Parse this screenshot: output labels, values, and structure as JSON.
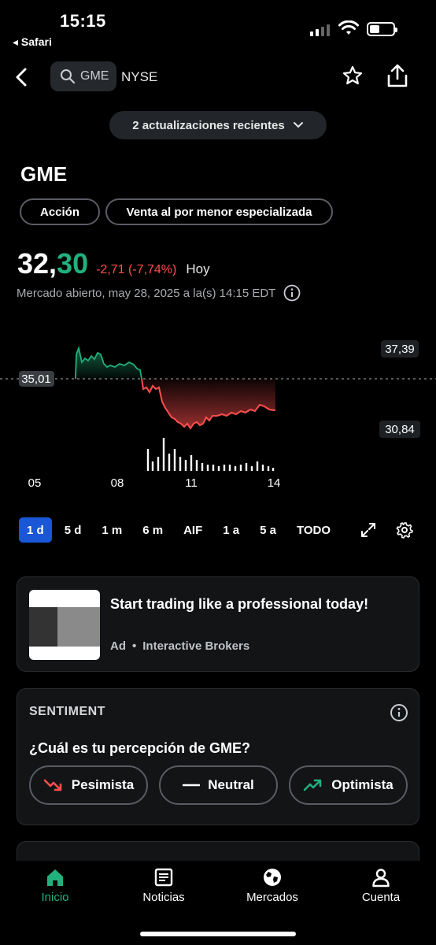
{
  "status": {
    "time": "15:15",
    "back_app": "◂ Safari"
  },
  "nav": {
    "search_text": "GME",
    "exchange": "NYSE"
  },
  "updates": {
    "label": "2 actualizaciones recientes"
  },
  "stock": {
    "ticker": "GME",
    "tags": [
      "Acción",
      "Venta al por menor especializada"
    ],
    "price_int": "32,",
    "price_dec": "30",
    "change": "-2,71 (-7,74%)",
    "period": "Hoy",
    "market_status": "Mercado abierto, may 28, 2025 a la(s) 14:15 EDT"
  },
  "chart_data": {
    "type": "line",
    "prev_close_label": "35,01",
    "high_label": "37,39",
    "low_label": "30,84",
    "x_ticks": [
      "05",
      "08",
      "11",
      "14"
    ],
    "colors": {
      "up": "#22b07d",
      "down": "#ff4e4e",
      "volume": "#ffffff"
    }
  },
  "ranges": [
    "1 d",
    "5 d",
    "1 m",
    "6 m",
    "AIF",
    "1 a",
    "5 a",
    "TODO"
  ],
  "active_range": "1 d",
  "ad": {
    "title": "Start trading like a professional today!",
    "label": "Ad",
    "sponsor": "Interactive Brokers"
  },
  "sentiment": {
    "title": "SENTIMENT",
    "question": "¿Cuál es tu percepción de GME?",
    "options": [
      "Pesimista",
      "Neutral",
      "Optimista"
    ]
  },
  "tabs": [
    "Inicio",
    "Noticias",
    "Mercados",
    "Cuenta"
  ],
  "icons": {
    "search": "search-icon",
    "star": "star-icon",
    "share": "share-icon",
    "home": "home-icon",
    "news": "news-icon",
    "globe": "globe-icon",
    "user": "user-icon"
  },
  "theme": {
    "accent_green": "#22b07d",
    "accent_red": "#ff4e4e",
    "active_blue": "#1a57d6"
  }
}
